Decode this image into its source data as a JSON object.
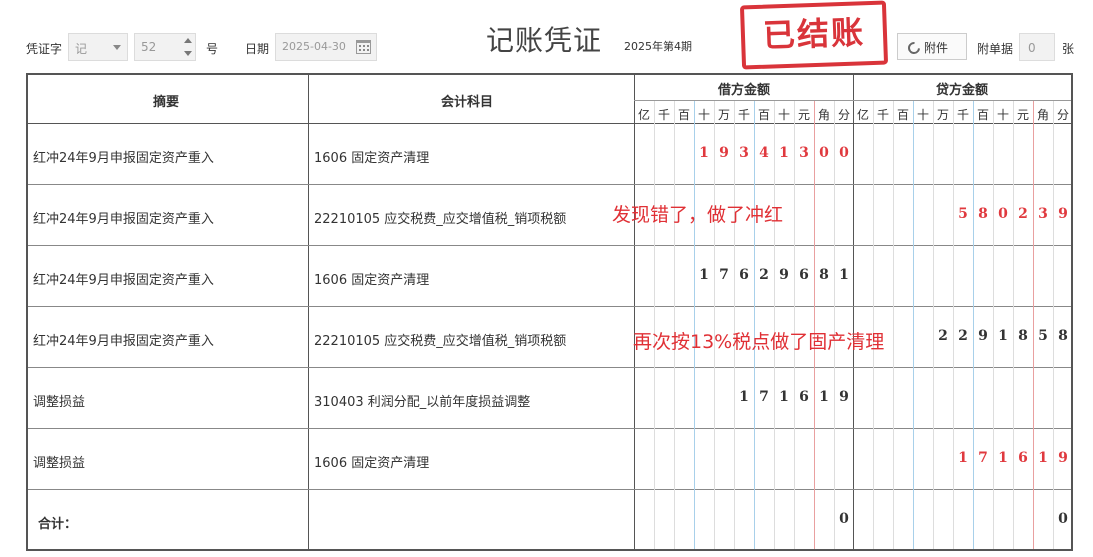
{
  "header": {
    "voucher_word_label": "凭证字",
    "voucher_word_value": "记",
    "voucher_number_value": "52",
    "number_suffix": "号",
    "date_label": "日期",
    "date_value": "2025-04-30",
    "title": "记账凭证",
    "period": "2025年第4期",
    "stamp": "已结账",
    "attachment_button": "附件",
    "attachment_count_label": "附单据",
    "attachment_count_value": "0",
    "attachment_unit": "张"
  },
  "table": {
    "col_summary": "摘要",
    "col_account": "会计科目",
    "col_debit": "借方金额",
    "col_credit": "贷方金额",
    "units": [
      "亿",
      "千",
      "百",
      "十",
      "万",
      "千",
      "百",
      "十",
      "元",
      "角",
      "分"
    ],
    "rows": [
      {
        "summary": "红冲24年9月申报固定资产重入",
        "account": "1606  固定资产清理",
        "debit": "19341300",
        "credit": "",
        "red": true
      },
      {
        "summary": "红冲24年9月申报固定资产重入",
        "account": "22210105  应交税费_应交增值税_销项税额",
        "debit": "",
        "credit": "580239",
        "red": true
      },
      {
        "summary": "红冲24年9月申报固定资产重入",
        "account": "1606  固定资产清理",
        "debit": "17629681",
        "credit": "",
        "red": false
      },
      {
        "summary": "红冲24年9月申报固定资产重入",
        "account": "22210105  应交税费_应交增值税_销项税额",
        "debit": "",
        "credit": "2291858",
        "red": false
      },
      {
        "summary": "调整损益",
        "account": "310403  利润分配_以前年度损益调整",
        "debit": "171619",
        "credit": "",
        "red": false
      },
      {
        "summary": "调整损益",
        "account": "1606  固定资产清理",
        "debit": "",
        "credit": "171619",
        "red": true
      }
    ],
    "total_label": "合计：",
    "total_debit": "0",
    "total_credit": "0"
  },
  "annotations": {
    "note_1": "发现错了，做了冲红",
    "note_2": "再次按13%税点做了固产清理"
  },
  "colors": {
    "red_amount": "#e0393e",
    "stamp": "#d9343a",
    "annotation": "#e03035"
  }
}
